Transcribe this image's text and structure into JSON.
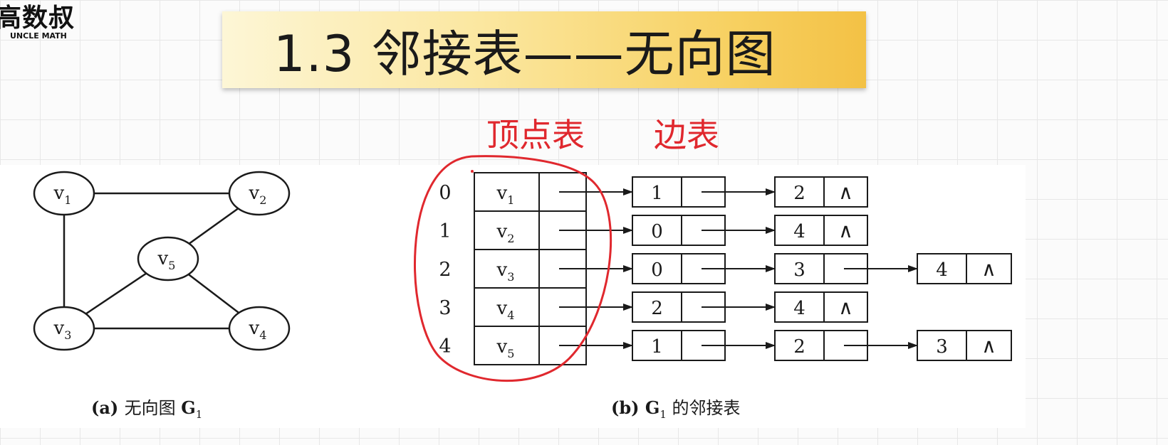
{
  "logo": {
    "cn": "高数叔",
    "en": "UNCLE MATH"
  },
  "title": "1.3 邻接表——无向图",
  "annotations": {
    "vertex_table": "顶点表",
    "edge_table": "边表"
  },
  "graph": {
    "nodes": [
      {
        "id": "v1",
        "label": "v",
        "sub": "1"
      },
      {
        "id": "v2",
        "label": "v",
        "sub": "2"
      },
      {
        "id": "v3",
        "label": "v",
        "sub": "3"
      },
      {
        "id": "v4",
        "label": "v",
        "sub": "4"
      },
      {
        "id": "v5",
        "label": "v",
        "sub": "5"
      }
    ],
    "edges": [
      [
        "v1",
        "v2"
      ],
      [
        "v1",
        "v3"
      ],
      [
        "v2",
        "v5"
      ],
      [
        "v3",
        "v5"
      ],
      [
        "v5",
        "v4"
      ],
      [
        "v3",
        "v4"
      ]
    ],
    "caption": {
      "prefix": "(a)",
      "text": "无向图 ",
      "g": "G",
      "sub": "1"
    }
  },
  "adjacency": {
    "rows": [
      {
        "index": "0",
        "vertex": "v",
        "sub": "1",
        "neighbors": [
          "1",
          "2"
        ]
      },
      {
        "index": "1",
        "vertex": "v",
        "sub": "2",
        "neighbors": [
          "0",
          "4"
        ]
      },
      {
        "index": "2",
        "vertex": "v",
        "sub": "3",
        "neighbors": [
          "0",
          "3",
          "4"
        ]
      },
      {
        "index": "3",
        "vertex": "v",
        "sub": "4",
        "neighbors": [
          "2",
          "4"
        ]
      },
      {
        "index": "4",
        "vertex": "v",
        "sub": "5",
        "neighbors": [
          "1",
          "2",
          "3"
        ]
      }
    ],
    "null_symbol": "∧",
    "caption": {
      "prefix": "(b)",
      "g": "G",
      "sub": "1",
      "text": " 的邻接表"
    }
  },
  "colors": {
    "ink": "#1a1a1a",
    "annotation_red": "#e0282e"
  }
}
